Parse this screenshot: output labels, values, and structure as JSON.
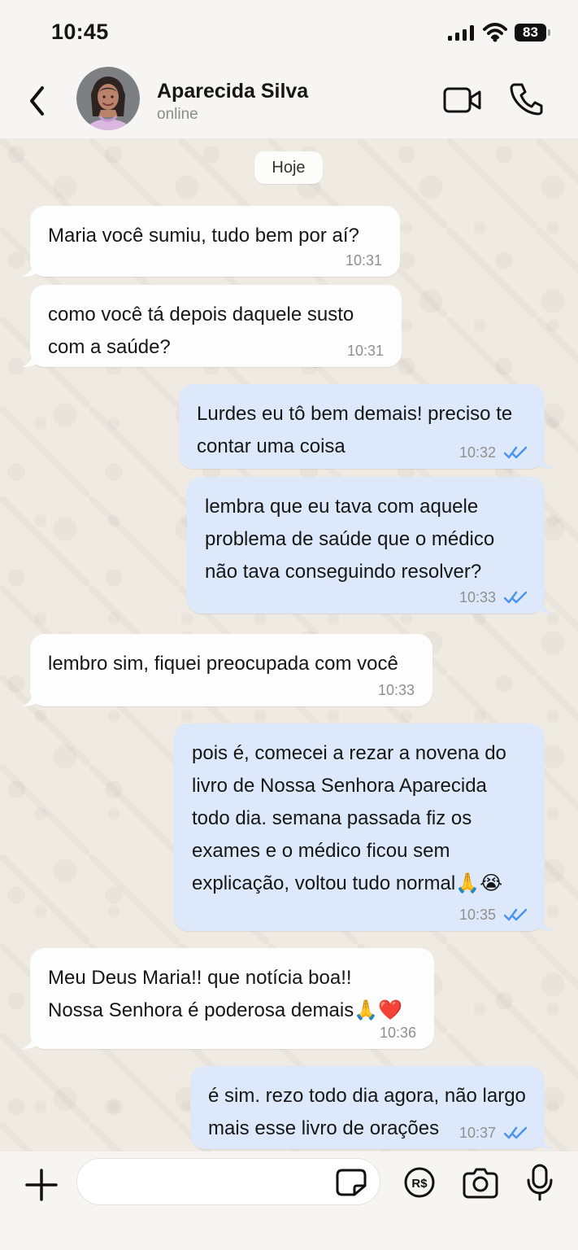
{
  "status_bar": {
    "time": "10:45",
    "battery": "83",
    "icons": [
      "signal-icon",
      "wifi-icon",
      "battery-icon"
    ]
  },
  "header": {
    "contact_name": "Aparecida Silva",
    "contact_status": "online",
    "icons": [
      "chevron-left-icon",
      "avatar",
      "video-camera-icon",
      "phone-icon"
    ]
  },
  "day_label": "Hoje",
  "messages": [
    {
      "direction": "incoming",
      "text": "Maria você sumiu, tudo bem por aí?",
      "time": "10:31"
    },
    {
      "direction": "incoming",
      "text": "como você tá depois daquele susto\ncom a saúde?",
      "time": "10:31"
    },
    {
      "direction": "outgoing",
      "text": "Lurdes eu tô bem demais! preciso te\ncontar uma coisa",
      "time": "10:32",
      "status": "read"
    },
    {
      "direction": "outgoing",
      "text": "lembra que eu tava com aquele\nproblema de saúde que o médico\nnão tava conseguindo resolver?",
      "time": "10:33",
      "status": "read"
    },
    {
      "direction": "incoming",
      "text": "lembro sim, fiquei preocupada com você",
      "time": "10:33"
    },
    {
      "direction": "outgoing",
      "text": "pois é, comecei a rezar a novena do\nlivro de Nossa Senhora Aparecida\ntodo dia. semana passada fiz os\nexames e o médico ficou sem\nexplicação, voltou tudo normal🙏😭",
      "time": "10:35",
      "status": "read"
    },
    {
      "direction": "incoming",
      "text": "Meu Deus Maria!! que notícia boa!!\nNossa Senhora é poderosa demais🙏❤️",
      "time": "10:36"
    },
    {
      "direction": "outgoing",
      "text": "é sim. rezo todo dia agora, não largo\nmais esse livro de orações",
      "time": "10:37",
      "status": "read"
    }
  ],
  "composer": {
    "input_value": "",
    "placeholder": "",
    "icons": [
      "plus-icon",
      "sticker-icon",
      "pix-icon",
      "camera-icon",
      "microphone-icon"
    ]
  },
  "colors": {
    "incoming_bubble": "#fdfdfd",
    "outgoing_bubble": "#dde9fb",
    "read_check": "#4b93ee",
    "wallpaper": "#efeae2"
  }
}
